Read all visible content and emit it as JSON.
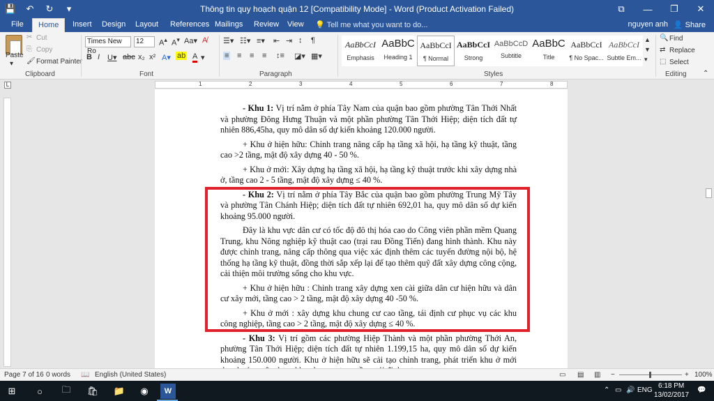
{
  "window": {
    "title": "Thông tin quy hoạch quận 12 [Compatibility Mode] - Word (Product Activation Failed)",
    "controls": {
      "restore": "⧉",
      "minimize": "—",
      "maximize": "❐",
      "close": "✕"
    }
  },
  "qat": {
    "save": "💾",
    "undo": "↶",
    "redo": "↻",
    "customize": "▾"
  },
  "tabs": {
    "file": "File",
    "home": "Home",
    "insert": "Insert",
    "design": "Design",
    "layout": "Layout",
    "references": "References",
    "mailings": "Mailings",
    "review": "Review",
    "view": "View",
    "tell_me": "Tell me what you want to do...",
    "user": "nguyen anh",
    "share": "Share"
  },
  "ribbon": {
    "clipboard": {
      "paste": "Paste",
      "cut": "Cut",
      "copy": "Copy",
      "format_painter": "Format Painter",
      "label": "Clipboard"
    },
    "font": {
      "name": "Times New Ro",
      "size": "12",
      "label": "Font"
    },
    "paragraph": {
      "label": "Paragraph"
    },
    "styles": {
      "label": "Styles",
      "items": [
        {
          "preview": "AaBbCcI",
          "name": "Emphasis"
        },
        {
          "preview": "AaBbC",
          "name": "Heading 1"
        },
        {
          "preview": "AaBbCcI",
          "name": "¶ Normal"
        },
        {
          "preview": "AaBbCcI",
          "name": "Strong"
        },
        {
          "preview": "AaBbCcD",
          "name": "Subtitle"
        },
        {
          "preview": "AaBbC",
          "name": "Title"
        },
        {
          "preview": "AaBbCcI",
          "name": "¶ No Spac..."
        },
        {
          "preview": "AaBbCcI",
          "name": "Subtle Em..."
        }
      ]
    },
    "editing": {
      "find": "Find",
      "replace": "Replace",
      "select": "Select",
      "label": "Editing"
    }
  },
  "ruler": {
    "numbers": [
      "1",
      "2",
      "3",
      "4",
      "5",
      "6",
      "7",
      "8"
    ],
    "tab_selector": "L"
  },
  "document": {
    "p1_bold": "- Khu 1:",
    "p1": " Vị trí nằm ở phía Tây Nam của quận bao gồm phường Tân Thới Nhất và phường Đông Hưng Thuận và một phần phường Tân Thới Hiệp; diện tích đất tự nhiên 886,45ha, quy mô dân số dự kiến  khoảng 120.000 người.",
    "p2": "+ Khu ở hiện hữu: Chỉnh trang nâng cấp hạ tầng xã hội, hạ tầng kỹ thuật, tầng cao >2 tầng, mật độ xây dựng 40 - 50 %.",
    "p3": "+ Khu ở mới: Xây dựng hạ tầng xã hội, hạ tầng kỹ thuật trước khi xây dựng nhà ở, tầng cao 2 - 5 tầng, mật độ xây dựng ≤ 40 %.",
    "p4_bold": "- Khu 2:",
    "p4": " Vị trí nằm ở phía Tây Bắc của quận bao gồm phường Trung Mỹ Tây và phường Tân Chánh Hiệp; diện tích đất tự nhiên 692,01 ha, quy mô dân số dự kiến khoảng 95.000 người.",
    "p5": "Đây là khu vực dân cư có tốc độ đô thị hóa cao do Công viên phần mềm Quang Trung, khu Nông nghiệp kỹ thuật cao (trại rau Đồng Tiến) đang hình thành. Khu này được chỉnh trang, nâng cấp thông qua việc xác định thêm các tuyến đường nội bộ, hệ thống hạ tầng kỹ thuật, đồng thời sắp xếp lại để tạo thêm quỹ đất xây dựng công cộng, cải thiện môi trường sống cho khu vực.",
    "p6": "+ Khu ở hiện hữu   : Chỉnh trang xây dựng xen cài giữa dân cư hiện hữu và dân cư xây mới, tầng cao > 2 tầng, mật độ xây dựng 40 -50 %.",
    "p7": "+ Khu ở mới          : xây dựng khu chung cư cao tầng, tái định cư phục vụ các khu công nghiệp, tầng cao > 2 tầng, mật độ xây dựng ≤ 40 %.",
    "p8_bold": "- Khu 3:",
    "p8": " Vị trí gồm các phường Hiệp Thành và một phần phường Thới An, phường Tân Thới Hiệp; diện tích đất tự nhiên 1.199,15 ha, quy mô dân số dự kiến khoảng 150.000 người. Khu ở hiện hữu sẽ cải tạo chỉnh trang, phát triển khu ở mới theo hướng xây dựng khu chung cư cao tầng, tái định cư"
  },
  "status": {
    "page": "Page 7 of 16",
    "words": "0 words",
    "language": "English (United States)",
    "zoom": "100%"
  },
  "taskbar": {
    "lang": "ENG",
    "time": "6:18 PM",
    "date": "13/02/2017"
  },
  "colors": {
    "accent": "#2b579a",
    "highlight_box": "#e0202a"
  }
}
